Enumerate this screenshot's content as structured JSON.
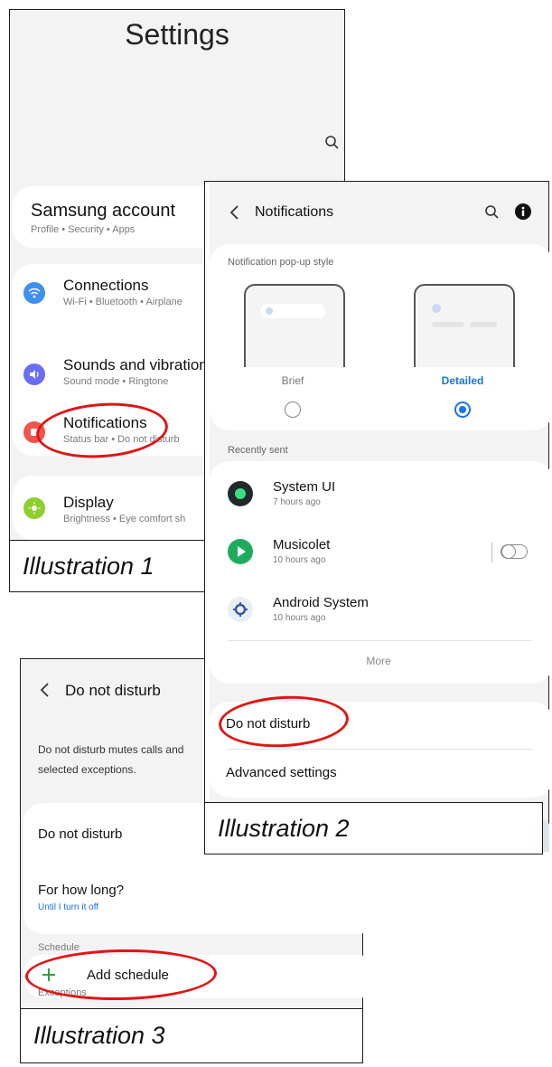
{
  "illustration1": {
    "title": "Settings",
    "caption": "Illustration 1",
    "account": {
      "title": "Samsung account",
      "subtitle": "Profile  •  Security  •  Apps"
    },
    "connections": {
      "title": "Connections",
      "subtitle": "Wi-Fi  •  Bluetooth  •  Airplane"
    },
    "sounds": {
      "title": "Sounds and vibration",
      "subtitle": "Sound mode  •  Ringtone"
    },
    "notifications": {
      "title": "Notifications",
      "subtitle": "Status bar  •  Do not disturb"
    },
    "display": {
      "title": "Display",
      "subtitle": "Brightness  •  Eye comfort sh"
    },
    "colors": {
      "connections": "#3d8ff0",
      "sounds": "#6a6ef0",
      "notifications": "#f0544a",
      "display": "#8ccf2f",
      "ring": "#e21414"
    }
  },
  "illustration2": {
    "title": "Notifications",
    "caption": "Illustration 2",
    "popup_section": "Notification pop-up style",
    "brief_label": "Brief",
    "detailed_label": "Detailed",
    "recent_section": "Recently sent",
    "apps": [
      {
        "name": "System UI",
        "time": "7 hours ago"
      },
      {
        "name": "Musicolet",
        "time": "10 hours ago"
      },
      {
        "name": "Android System",
        "time": "10 hours ago"
      }
    ],
    "more_label": "More",
    "dnd_label": "Do not disturb",
    "advanced_label": "Advanced settings",
    "colors": {
      "accent": "#1a73e8"
    }
  },
  "illustration3": {
    "title": "Do not disturb",
    "caption": "Illustration 3",
    "description": "Do not disturb mutes calls and selected exceptions.",
    "dnd_label": "Do not disturb",
    "how_long_label": "For how long?",
    "how_long_value": "Until I turn it off",
    "schedule_section": "Schedule",
    "add_schedule_label": "Add schedule",
    "exceptions_section": "Exceptions",
    "colors": {
      "plus": "#2e9e42",
      "link": "#1a73e8"
    }
  }
}
